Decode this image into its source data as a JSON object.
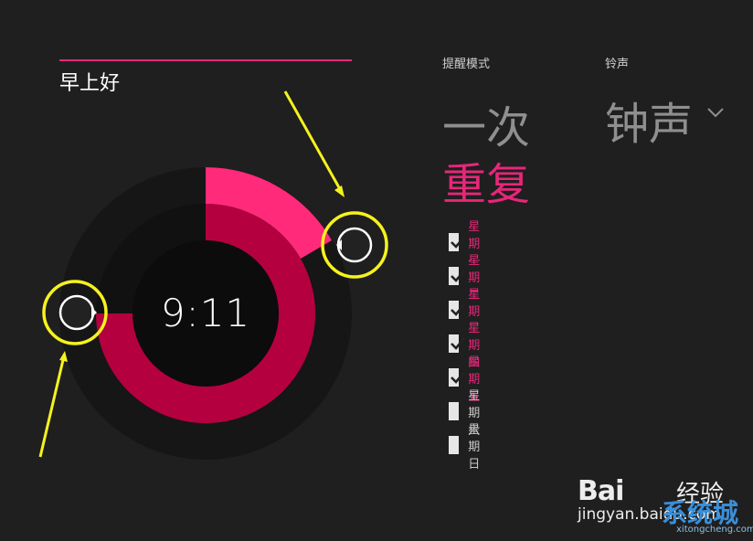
{
  "alarm": {
    "name": "早上好",
    "time": "9:11"
  },
  "mode": {
    "label": "提醒模式",
    "options": [
      "一次",
      "重复"
    ],
    "selected": "重复"
  },
  "ringtone": {
    "label": "铃声",
    "value": "钟声"
  },
  "days": [
    {
      "label": "星期一",
      "checked": true
    },
    {
      "label": "星期二",
      "checked": true
    },
    {
      "label": "星期三",
      "checked": true
    },
    {
      "label": "星期四",
      "checked": true
    },
    {
      "label": "星期五",
      "checked": true
    },
    {
      "label": "星期六",
      "checked": false
    },
    {
      "label": "星期日",
      "checked": false
    }
  ],
  "colors": {
    "accent": "#e8267a",
    "accent_dark": "#b5003f",
    "annotation": "#f5f21e",
    "background": "#1f1f1f"
  },
  "watermark": {
    "baidu": "Bai",
    "baidu_suffix": "经验",
    "url": "jingyan.baidu.com",
    "site": "系统城",
    "site_url": "xitongcheng.com"
  }
}
